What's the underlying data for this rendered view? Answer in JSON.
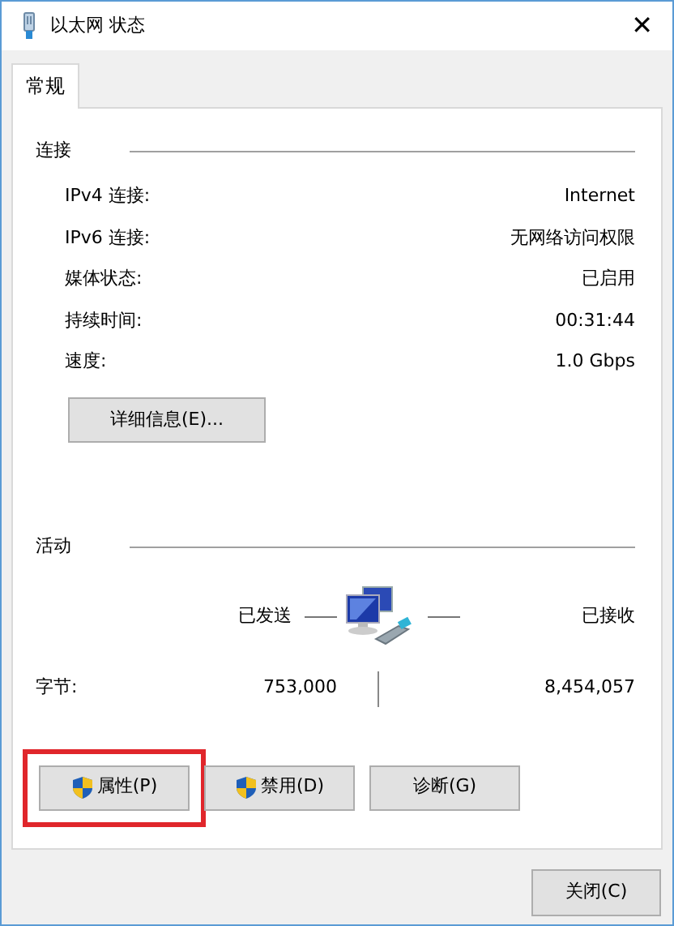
{
  "window": {
    "title": "以太网 状态",
    "close": "✕"
  },
  "tabs": [
    {
      "label": "常规",
      "selected": true
    }
  ],
  "connection": {
    "heading": "连接",
    "rows": [
      {
        "label": "IPv4 连接:",
        "value": "Internet"
      },
      {
        "label": "IPv6 连接:",
        "value": "无网络访问权限"
      },
      {
        "label": "媒体状态:",
        "value": "已启用"
      },
      {
        "label": "持续时间:",
        "value": "00:31:44"
      },
      {
        "label": "速度:",
        "value": "1.0 Gbps"
      }
    ],
    "details_button": "详细信息(E)..."
  },
  "activity": {
    "heading": "活动",
    "sent_label": "已发送",
    "received_label": "已接收",
    "bytes_label": "字节:",
    "sent": "753,000",
    "received": "8,454,057"
  },
  "buttons": [
    {
      "label": "属性(P)",
      "shield": true,
      "highlighted": true
    },
    {
      "label": "禁用(D)",
      "shield": true,
      "highlighted": false
    },
    {
      "label": "诊断(G)",
      "shield": false,
      "highlighted": false
    }
  ],
  "close_button": "关闭(C)"
}
